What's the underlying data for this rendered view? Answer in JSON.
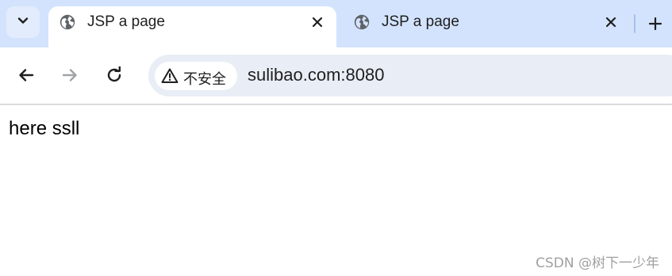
{
  "tabs": [
    {
      "title": "JSP a page",
      "active": true,
      "icon": "globe-icon"
    },
    {
      "title": "JSP a page",
      "active": false,
      "icon": "globe-icon"
    }
  ],
  "toolbar": {
    "security_label": "不安全",
    "url": "sulibao.com:8080"
  },
  "page": {
    "text": "here ssll"
  },
  "watermark": "CSDN @树下一少年",
  "colors": {
    "tabstrip": "#d3e3fd",
    "omnibox": "#e9eef6",
    "text": "#1f1f1f"
  }
}
